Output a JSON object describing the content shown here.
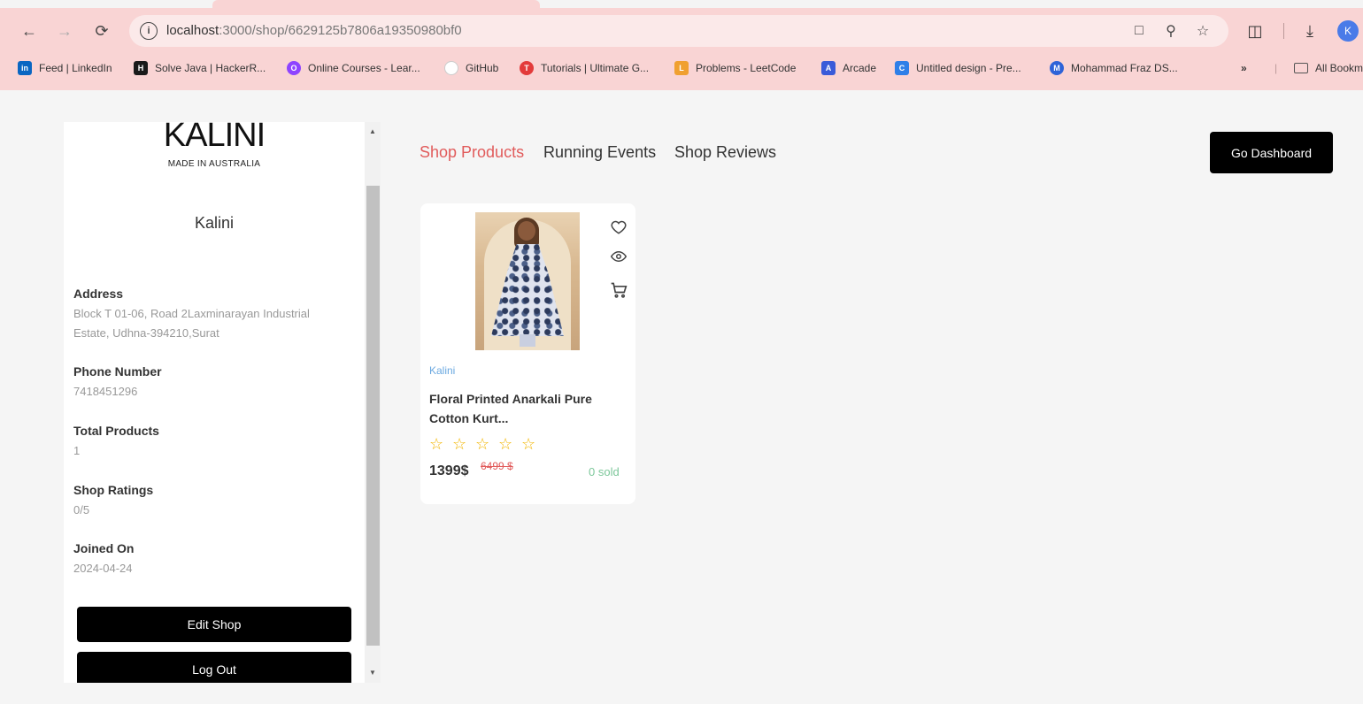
{
  "browser": {
    "url_host": "localhost",
    "url_path": ":3000/shop/6629125b7806a19350980bf0",
    "avatar_letter": "K",
    "bookmarks": [
      {
        "label": "Feed | LinkedIn",
        "icon": "linkedin-icon",
        "color": "#0a66c2",
        "glyph": "in"
      },
      {
        "label": "Solve Java | HackerR...",
        "icon": "hackerrank-icon",
        "color": "#1a1a1a",
        "glyph": "H"
      },
      {
        "label": "Online Courses - Lear...",
        "icon": "courses-icon",
        "color": "#8e44ff",
        "glyph": "O"
      },
      {
        "label": "GitHub",
        "icon": "github-icon",
        "color": "#dddddd",
        "glyph": ""
      },
      {
        "label": "Tutorials | Ultimate G...",
        "icon": "tutorials-icon",
        "color": "#e33b3b",
        "glyph": "T"
      },
      {
        "label": "Problems - LeetCode",
        "icon": "leetcode-icon",
        "color": "#f0a030",
        "glyph": "L"
      },
      {
        "label": "Arcade",
        "icon": "arcade-icon",
        "color": "#3a5bd9",
        "glyph": "A"
      },
      {
        "label": "Untitled design - Pre...",
        "icon": "canva-icon",
        "color": "#2f7fe8",
        "glyph": "C"
      },
      {
        "label": "Mohammad Fraz DS...",
        "icon": "profile-icon",
        "color": "#2e63d8",
        "glyph": "M"
      }
    ],
    "all_bookmarks_label": "All Bookm"
  },
  "shop": {
    "logo": "KALINI",
    "logo_subtitle": "MADE IN AUSTRALIA",
    "name": "Kalini",
    "address_label": "Address",
    "address": "Block T 01-06, Road 2Laxminarayan Industrial Estate, Udhna-394210,Surat",
    "phone_label": "Phone Number",
    "phone": "7418451296",
    "total_products_label": "Total Products",
    "total_products": "1",
    "ratings_label": "Shop Ratings",
    "ratings": "0/5",
    "joined_label": "Joined On",
    "joined": "2024-04-24",
    "edit_button": "Edit Shop",
    "logout_button": "Log Out"
  },
  "tabs": {
    "products": "Shop Products",
    "events": "Running Events",
    "reviews": "Shop Reviews",
    "active": "products"
  },
  "dashboard_button": "Go Dashboard",
  "product": {
    "brand": "Kalini",
    "name": "Floral Printed Anarkali Pure Cotton Kurt...",
    "rating": 0,
    "max_rating": 5,
    "price": "1399$",
    "original_price": "6499 $",
    "sold": "0 sold"
  },
  "colors": {
    "accent": "#e15b5b",
    "star": "#f2b600",
    "sold": "#7cc79a",
    "brand_link": "#6aa8e0"
  }
}
